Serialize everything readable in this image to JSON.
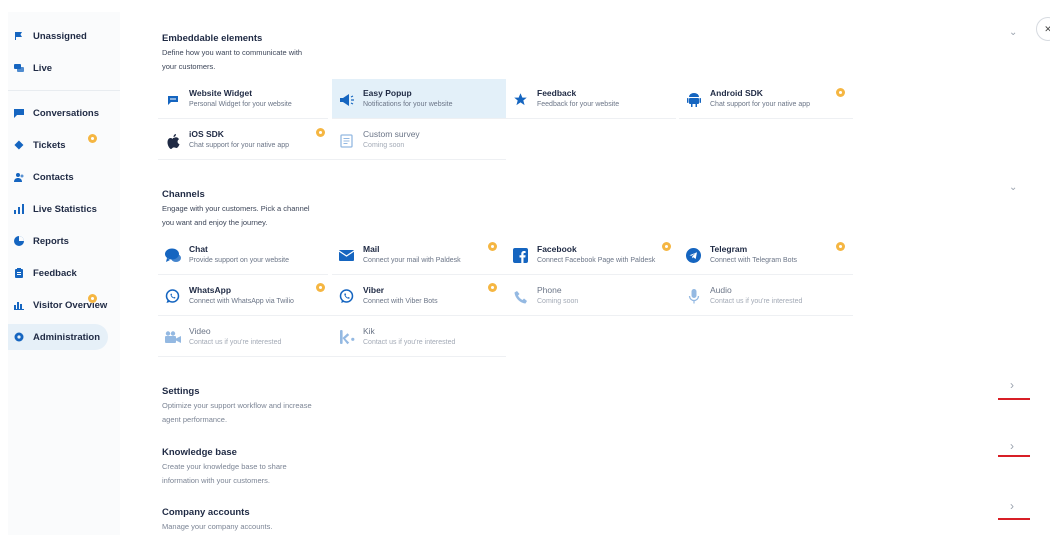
{
  "sidebar": {
    "items": [
      {
        "label": "Unassigned",
        "icon": "flag-icon"
      },
      {
        "label": "Live",
        "icon": "chat-bubbles-icon"
      },
      {
        "label": "Conversations",
        "icon": "message-icon"
      },
      {
        "label": "Tickets",
        "icon": "ticket-icon"
      },
      {
        "label": "Contacts",
        "icon": "contacts-icon"
      },
      {
        "label": "Live Statistics",
        "icon": "bar-chart-icon"
      },
      {
        "label": "Reports",
        "icon": "pie-chart-icon"
      },
      {
        "label": "Feedback",
        "icon": "clipboard-icon"
      },
      {
        "label": "Visitor Overview",
        "icon": "visitor-chart-icon"
      },
      {
        "label": "Administration",
        "icon": "settings-gear-icon"
      }
    ]
  },
  "embeddable": {
    "title": "Embeddable elements",
    "desc_line1": "Define how you want to communicate with",
    "desc_line2": "your customers.",
    "cards": [
      {
        "title": "Website Widget",
        "sub": "Personal Widget for your website"
      },
      {
        "title": "Easy Popup",
        "sub": "Notifications for your website"
      },
      {
        "title": "Feedback",
        "sub": "Feedback for your website"
      },
      {
        "title": "Android SDK",
        "sub": "Chat support for your native app"
      },
      {
        "title": "iOS SDK",
        "sub": "Chat support for your native app"
      },
      {
        "title": "Custom survey",
        "sub": "Coming soon"
      }
    ]
  },
  "channels": {
    "title": "Channels",
    "desc_line1": "Engage with your customers. Pick a channel",
    "desc_line2": "you want and enjoy the journey.",
    "cards": [
      {
        "title": "Chat",
        "sub": "Provide support on your website"
      },
      {
        "title": "Mail",
        "sub": "Connect your mail with Paldesk"
      },
      {
        "title": "Facebook",
        "sub": "Connect Facebook Page with Paldesk"
      },
      {
        "title": "Telegram",
        "sub": "Connect with Telegram Bots"
      },
      {
        "title": "WhatsApp",
        "sub": "Connect with WhatsApp via Twilio"
      },
      {
        "title": "Viber",
        "sub": "Connect with Viber Bots"
      },
      {
        "title": "Phone",
        "sub": "Coming soon"
      },
      {
        "title": "Audio",
        "sub": "Contact us if you're interested"
      },
      {
        "title": "Video",
        "sub": "Contact us if you're interested"
      },
      {
        "title": "Kik",
        "sub": "Contact us if you're interested"
      }
    ]
  },
  "settings": {
    "title": "Settings",
    "desc_line1": "Optimize your support workflow and increase",
    "desc_line2": "agent performance."
  },
  "knowledge": {
    "title": "Knowledge base",
    "desc_line1": "Create your knowledge base to share",
    "desc_line2": "information with your customers."
  },
  "company": {
    "title": "Company accounts",
    "desc_line1": "Manage your company accounts."
  },
  "glyphs": {
    "chevron_down": "⌄",
    "chevron_right": "›",
    "close": "✕"
  },
  "colors": {
    "accent": "#1565c0",
    "badge": "#f5b642",
    "highlight": "#e3f0f9",
    "annotation_red": "#d81f26"
  }
}
